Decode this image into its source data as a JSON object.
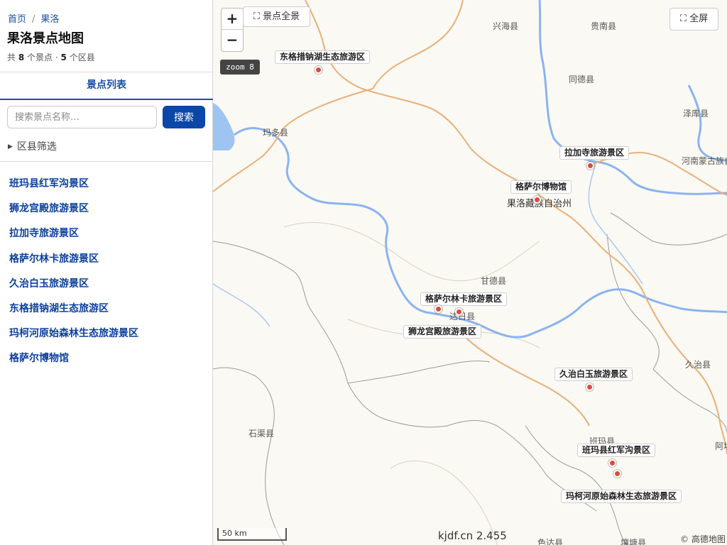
{
  "breadcrumb": {
    "home": "首页",
    "separator": "/",
    "current": "果洛"
  },
  "page_title": "果洛景点地图",
  "stats": {
    "prefix": "共",
    "spot_count": "8",
    "spot_unit": "个景点 ·",
    "county_count": "5",
    "county_unit": "个区县"
  },
  "list_tab": "景点列表",
  "search": {
    "placeholder": "搜索景点名称…",
    "button": "搜索"
  },
  "filter_label": "区县筛选",
  "spots": [
    "班玛县红军沟景区",
    "狮龙宫殿旅游景区",
    "拉加寺旅游景区",
    "格萨尔林卡旅游景区",
    "久治白玉旅游景区",
    "东格措钠湖生态旅游区",
    "玛柯河原始森林生态旅游景区",
    "格萨尔博物馆"
  ],
  "map": {
    "zoom_in": "+",
    "zoom_out": "−",
    "overview_button": "⛶ 景点全景",
    "fullscreen_button": "⛶ 全屏",
    "zoom_badge": "zoom 8",
    "scale_label": "50 km",
    "watermark": "kjdf.cn 2.455",
    "attribution": "© 高德地图",
    "places": [
      "兴海县",
      "贵南县",
      "同德县",
      "泽库县",
      "河南蒙古族自",
      "玛多县",
      "果洛藏族自治州",
      "甘德县",
      "达日县",
      "久治县",
      "石渠县",
      "班玛县",
      "阿坝",
      "色达县",
      "壤塘县"
    ],
    "poi_labels": [
      "东格措钠湖生态旅游区",
      "拉加寺旅游景区",
      "格萨尔博物馆",
      "格萨尔林卡旅游景区",
      "狮龙宫殿旅游景区",
      "久治白玉旅游景区",
      "班玛县红军沟景区",
      "玛柯河原始森林生态旅游景区"
    ],
    "colors": {
      "land": "#fbf9f3",
      "river": "#8ab4f0",
      "road": "#e8b07a",
      "boundary": "#9a9a9a",
      "marker": "#e04a3c"
    }
  }
}
